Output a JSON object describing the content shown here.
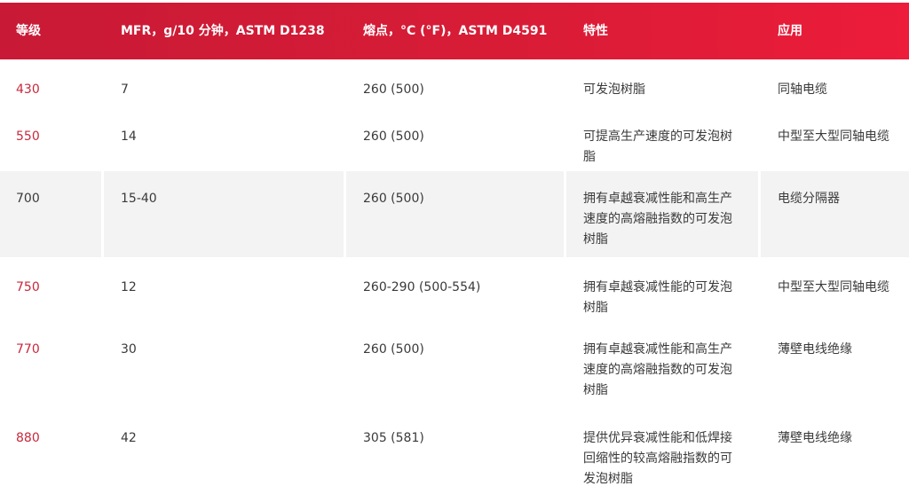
{
  "table": {
    "headers": [
      "等级",
      "MFR，g/10 分钟，ASTM D1238",
      "熔点，°C (°F)，ASTM D4591",
      "特性",
      "应用"
    ],
    "rows": [
      {
        "grade": "430",
        "mfr": "7",
        "melting_point": "260 (500)",
        "feature": "可发泡树脂",
        "application": "同轴电缆"
      },
      {
        "grade": "550",
        "mfr": "14",
        "melting_point": "260 (500)",
        "feature": "可提高生产速度的可发泡树脂",
        "application": "中型至大型同轴电缆"
      },
      {
        "grade": "700",
        "mfr": "15-40",
        "melting_point": "260 (500)",
        "feature": "拥有卓越衰减性能和高生产速度的高熔融指数的可发泡树脂",
        "application": "电缆分隔器"
      },
      {
        "grade": "750",
        "mfr": "12",
        "melting_point": "260-290 (500-554)",
        "feature": "拥有卓越衰减性能的可发泡树脂",
        "application": "中型至大型同轴电缆"
      },
      {
        "grade": "770",
        "mfr": "30",
        "melting_point": "260 (500)",
        "feature": "拥有卓越衰减性能和高生产速度的高熔融指数的可发泡树脂",
        "application": "薄壁电线绝缘"
      },
      {
        "grade": "880",
        "mfr": "42",
        "melting_point": "305 (581)",
        "feature": "提供优异衰减性能和低焊接回缩性的较高熔融指数的可发泡树脂",
        "application": "薄壁电线绝缘"
      }
    ]
  },
  "colors": {
    "header_red": "#d81c36",
    "grade_red": "#c8283c",
    "row_shade": "#f3f3f3"
  }
}
